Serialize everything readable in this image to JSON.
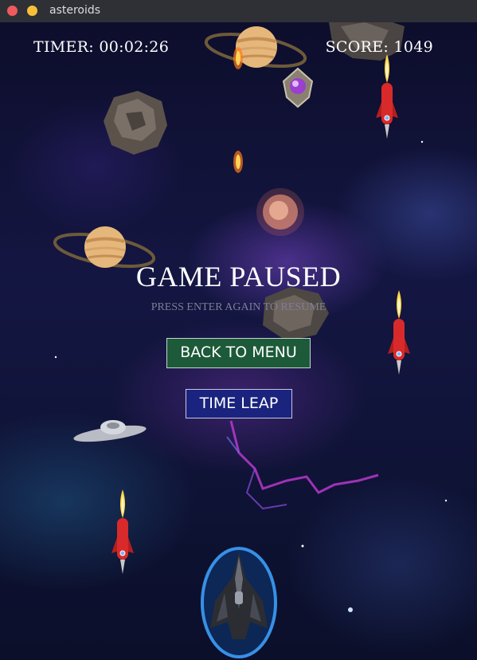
{
  "window": {
    "title": "asteroids"
  },
  "hud": {
    "timer": "TIMER: 00:02:26",
    "score": "SCORE: 1049"
  },
  "pause_overlay": {
    "title": "GAME PAUSED",
    "subtitle": "PRESS ENTER AGAIN TO RESUME",
    "back_to_menu_label": "BACK TO MENU",
    "time_leap_label": "TIME LEAP"
  },
  "colors": {
    "back_to_menu_bg": "#1d5a3a",
    "time_leap_bg": "#1a237e",
    "subtitle_text": "#7d7f96"
  },
  "sprites": [
    "saturn-planet-icon",
    "asteroid-icon",
    "fireball-icon",
    "purple-gem-powerup-icon",
    "rocket-icon",
    "ufo-icon",
    "player-spaceship-icon"
  ]
}
